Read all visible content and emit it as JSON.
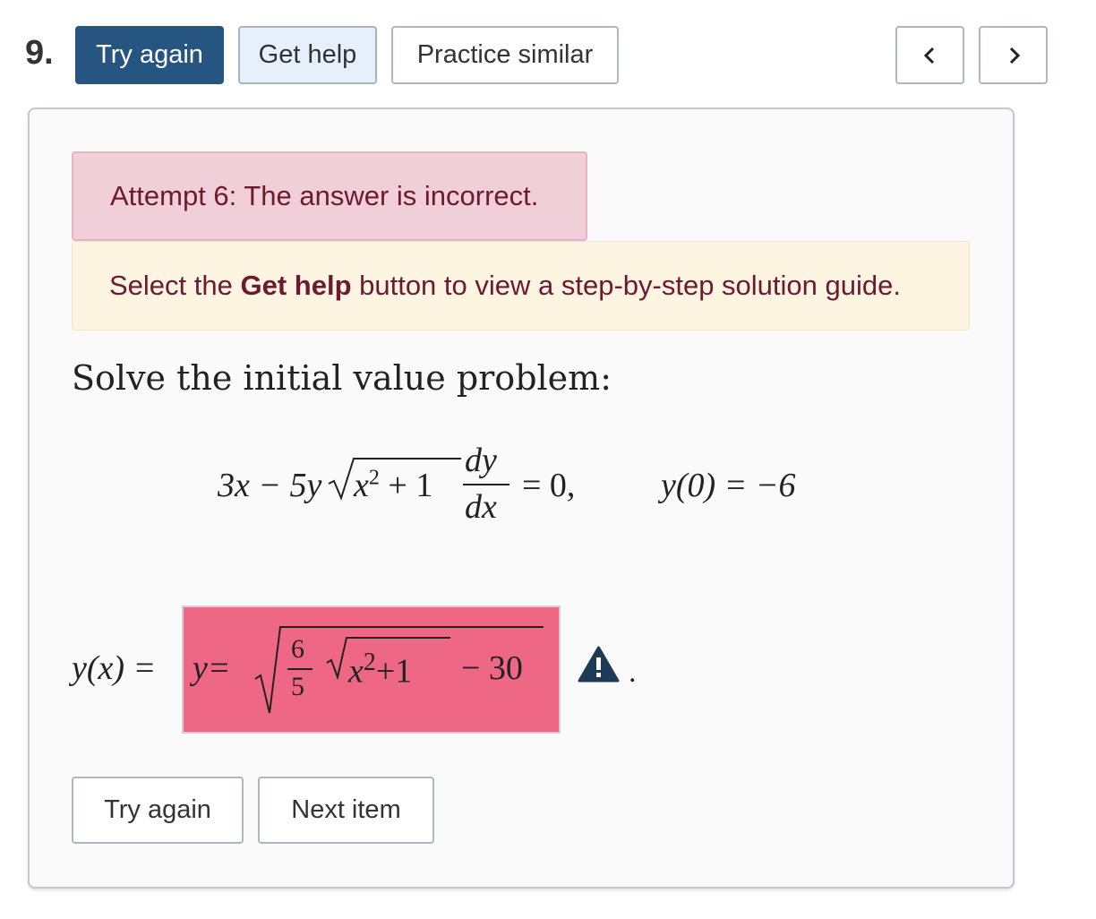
{
  "toolbar": {
    "question_number": "9.",
    "try_again_label": "Try again",
    "get_help_label": "Get help",
    "practice_similar_label": "Practice similar"
  },
  "feedback": {
    "incorrect_message": "Attempt 6: The answer is incorrect.",
    "hint_prefix": "Select the ",
    "hint_bold": "Get help",
    "hint_suffix": " button to view a step-by-step solution guide."
  },
  "question": {
    "prompt": "Solve the initial value problem:",
    "equation": {
      "lhs_start": "3x − 5y",
      "radicand_base": "x",
      "radicand_exp": "2",
      "radicand_tail": " + 1",
      "deriv_num": "dy",
      "deriv_den": "dx",
      "equals_zero": "= 0,",
      "initial_condition": "y(0) = −6"
    },
    "answer_label": "y(x) =",
    "answer": {
      "prefix": "y=",
      "frac_num": "6",
      "frac_den": "5",
      "inner_base": "x",
      "inner_exp": "2",
      "inner_tail": "+1",
      "tail": "− 30"
    },
    "period": "."
  },
  "actions": {
    "try_again_label": "Try again",
    "next_item_label": "Next item"
  },
  "colors": {
    "primary_button": "#255580",
    "get_help_button": "#e6f0fc",
    "incorrect_alert": "#f1cfd8",
    "hint_alert": "#fdf4e2",
    "answer_error": "#ee6885",
    "warning_icon": "#1d3a57"
  }
}
